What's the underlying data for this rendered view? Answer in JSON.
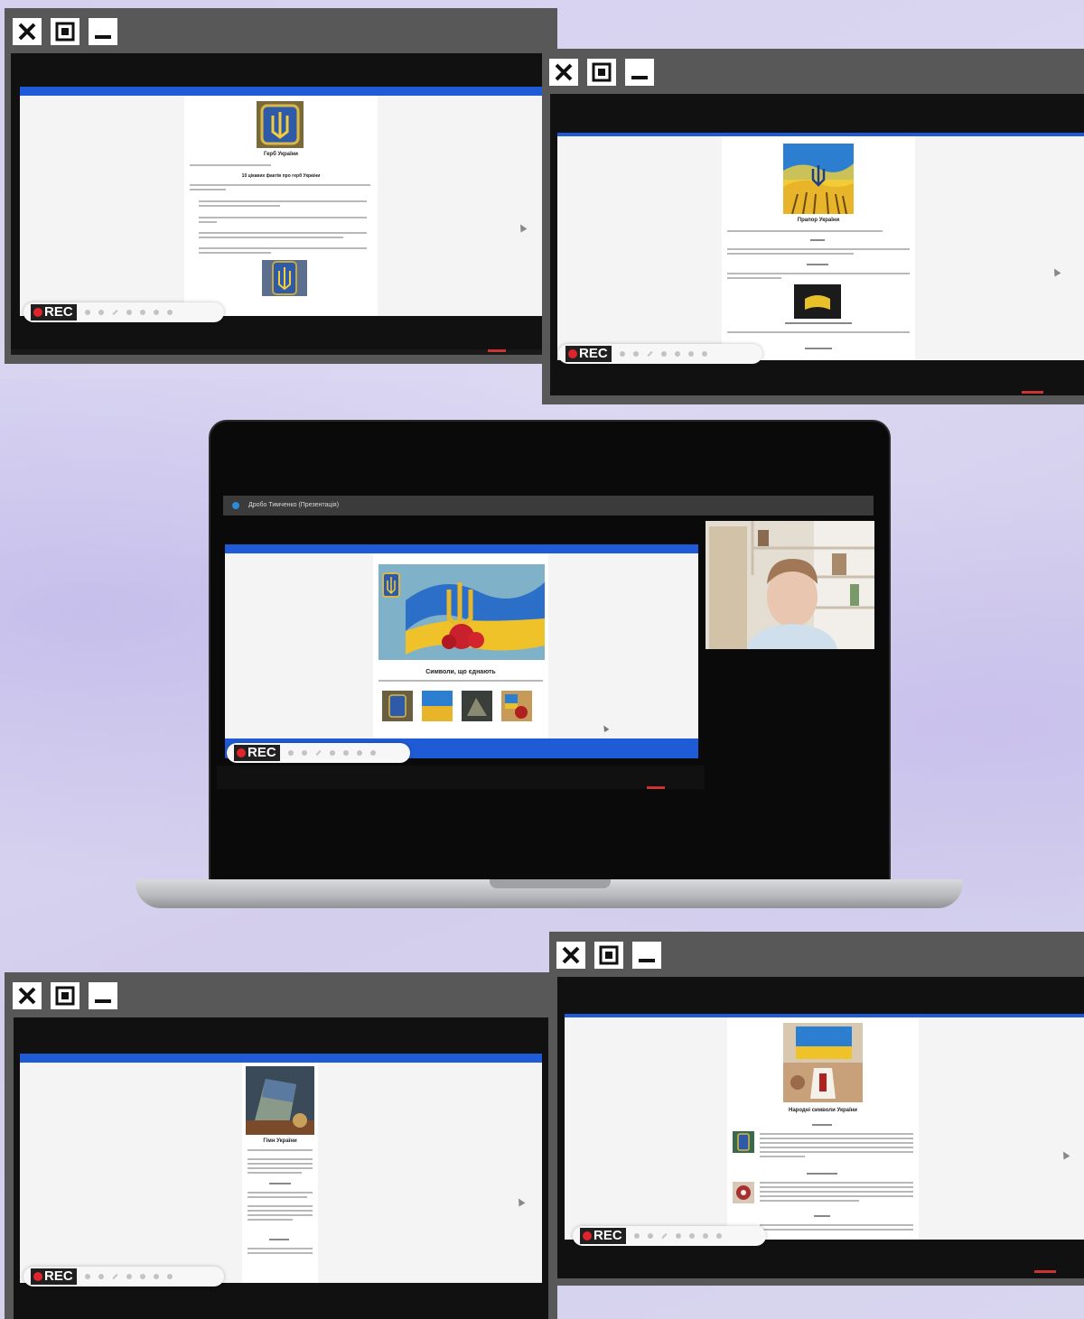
{
  "window_controls": {
    "close": "close",
    "maximize": "maximize",
    "minimize": "minimize"
  },
  "recorder": {
    "badge": "REC"
  },
  "windows": {
    "top_left": {
      "page_title": "Герб України",
      "heading": "10 цікавих фактів про герб України"
    },
    "top_right": {
      "page_title": "Прапор України"
    },
    "bottom_left": {
      "page_title": "Гімн України"
    },
    "bottom_right": {
      "page_title": "Народні символи України"
    }
  },
  "laptop": {
    "meeting_title": "Дробо Тимченко (Презентація)",
    "page_heading": "Символи, що єднають",
    "icons": [
      "microphone-icon",
      "camera-icon",
      "screen-share-icon",
      "hangup-icon"
    ]
  },
  "colors": {
    "accent_blue": "#1f5bd6",
    "rec_red": "#e0242c",
    "window_frame": "#585858"
  }
}
